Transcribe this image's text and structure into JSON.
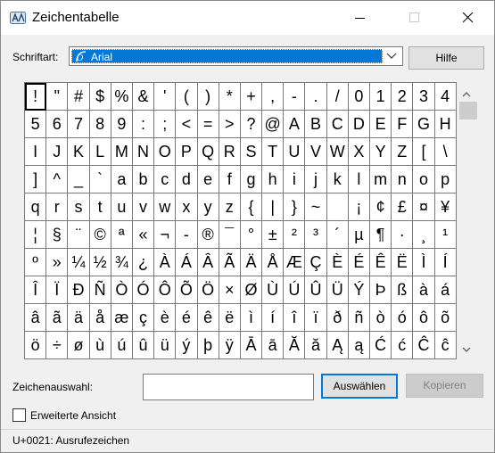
{
  "window": {
    "title": "Zeichentabelle"
  },
  "toolbar": {
    "font_label": "Schriftart:",
    "font_value": "Arial",
    "help_label": "Hilfe"
  },
  "characters": [
    "!",
    "\"",
    "#",
    "$",
    "%",
    "&",
    "'",
    "(",
    ")",
    "*",
    "+",
    ",",
    "-",
    ".",
    "/",
    "0",
    "1",
    "2",
    "3",
    "4",
    "5",
    "6",
    "7",
    "8",
    "9",
    ":",
    ";",
    "<",
    "=",
    ">",
    "?",
    "@",
    "A",
    "B",
    "C",
    "D",
    "E",
    "F",
    "G",
    "H",
    "I",
    "J",
    "K",
    "L",
    "M",
    "N",
    "O",
    "P",
    "Q",
    "R",
    "S",
    "T",
    "U",
    "V",
    "W",
    "X",
    "Y",
    "Z",
    "[",
    "\\",
    "]",
    "^",
    "_",
    "`",
    "a",
    "b",
    "c",
    "d",
    "e",
    "f",
    "g",
    "h",
    "i",
    "j",
    "k",
    "l",
    "m",
    "n",
    "o",
    "p",
    "q",
    "r",
    "s",
    "t",
    "u",
    "v",
    "w",
    "x",
    "y",
    "z",
    "{",
    "|",
    "}",
    "~",
    " ",
    "¡",
    "¢",
    "£",
    "¤",
    "¥",
    "¦",
    "§",
    "¨",
    "©",
    "ª",
    "«",
    "¬",
    "-",
    "®",
    "¯",
    "°",
    "±",
    "²",
    "³",
    "´",
    "µ",
    "¶",
    "·",
    "¸",
    "¹",
    "º",
    "»",
    "¼",
    "½",
    "¾",
    "¿",
    "À",
    "Á",
    "Â",
    "Ã",
    "Ä",
    "Å",
    "Æ",
    "Ç",
    "È",
    "É",
    "Ê",
    "Ë",
    "Ì",
    "Í",
    "Î",
    "Ï",
    "Ð",
    "Ñ",
    "Ò",
    "Ó",
    "Ô",
    "Õ",
    "Ö",
    "×",
    "Ø",
    "Ù",
    "Ú",
    "Û",
    "Ü",
    "Ý",
    "Þ",
    "ß",
    "à",
    "á",
    "â",
    "ã",
    "ä",
    "å",
    "æ",
    "ç",
    "è",
    "é",
    "ê",
    "ë",
    "ì",
    "í",
    "î",
    "ï",
    "ð",
    "ñ",
    "ò",
    "ó",
    "ô",
    "õ",
    "ö",
    "÷",
    "ø",
    "ù",
    "ú",
    "û",
    "ü",
    "ý",
    "þ",
    "ÿ",
    "Ā",
    "ā",
    "Ă",
    "ă",
    "Ą",
    "ą",
    "Ć",
    "ć",
    "Ĉ",
    "ĉ"
  ],
  "selection": {
    "label": "Zeichenauswahl:",
    "value": "",
    "select_label": "Auswählen",
    "copy_label": "Kopieren"
  },
  "advanced": {
    "label": "Erweiterte Ansicht",
    "checked": false
  },
  "status": {
    "text": "U+0021: Ausrufezeichen"
  },
  "colors": {
    "accent": "#0078d7",
    "window_bg": "#f0f0f0",
    "grid_line": "#7a7a7a"
  }
}
